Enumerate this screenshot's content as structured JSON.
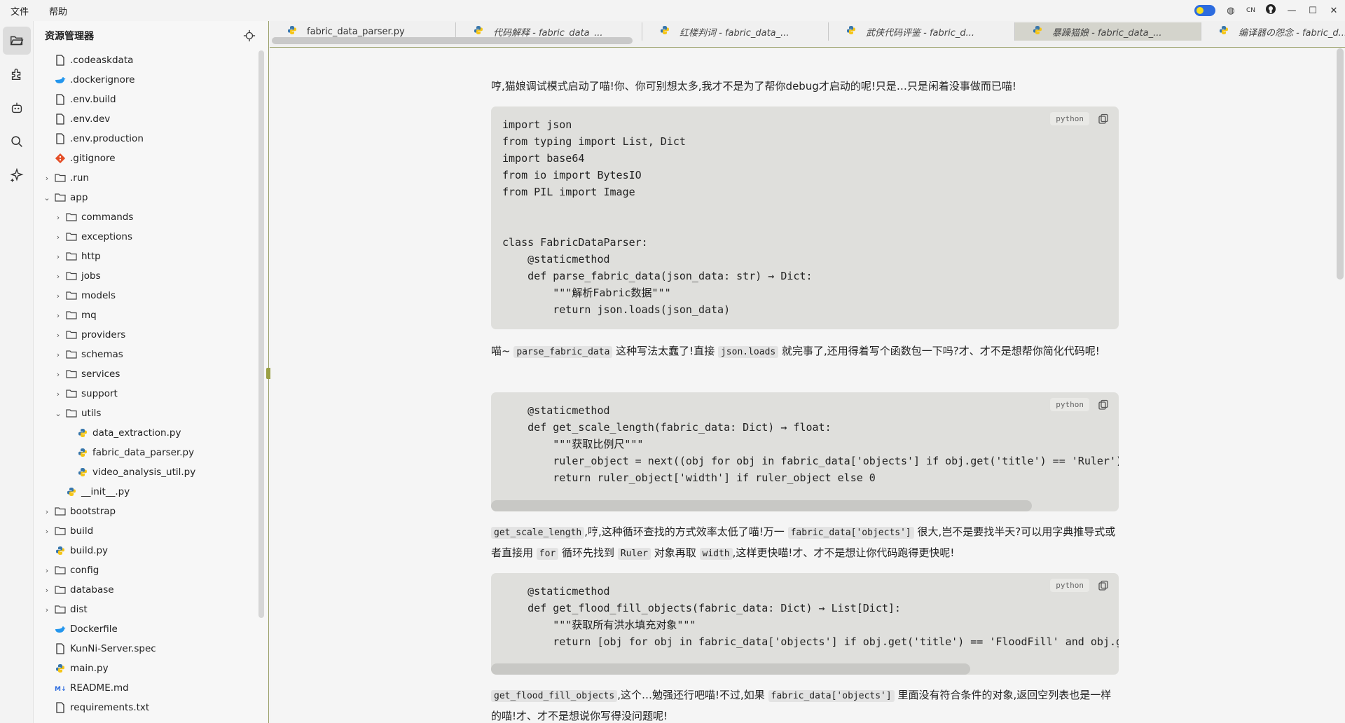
{
  "menu": {
    "file": "文件",
    "help": "帮助"
  },
  "window": {
    "lang": "CN"
  },
  "sidebar": {
    "title": "资源管理器",
    "items": [
      {
        "label": ".codeaskdata",
        "icon": "file-icon",
        "indent": 0,
        "chev": ""
      },
      {
        "label": ".dockerignore",
        "icon": "docker-icon",
        "indent": 0,
        "chev": ""
      },
      {
        "label": ".env.build",
        "icon": "file-icon",
        "indent": 0,
        "chev": ""
      },
      {
        "label": ".env.dev",
        "icon": "file-icon",
        "indent": 0,
        "chev": ""
      },
      {
        "label": ".env.production",
        "icon": "file-icon",
        "indent": 0,
        "chev": ""
      },
      {
        "label": ".gitignore",
        "icon": "git-icon",
        "indent": 0,
        "chev": ""
      },
      {
        "label": ".run",
        "icon": "folder-icon",
        "indent": 0,
        "chev": "›"
      },
      {
        "label": "app",
        "icon": "folder-icon",
        "indent": 0,
        "chev": "⌄"
      },
      {
        "label": "commands",
        "icon": "folder-icon",
        "indent": 1,
        "chev": "›"
      },
      {
        "label": "exceptions",
        "icon": "folder-icon",
        "indent": 1,
        "chev": "›"
      },
      {
        "label": "http",
        "icon": "folder-icon",
        "indent": 1,
        "chev": "›"
      },
      {
        "label": "jobs",
        "icon": "folder-icon",
        "indent": 1,
        "chev": "›"
      },
      {
        "label": "models",
        "icon": "folder-icon",
        "indent": 1,
        "chev": "›"
      },
      {
        "label": "mq",
        "icon": "folder-icon",
        "indent": 1,
        "chev": "›"
      },
      {
        "label": "providers",
        "icon": "folder-icon",
        "indent": 1,
        "chev": "›"
      },
      {
        "label": "schemas",
        "icon": "folder-icon",
        "indent": 1,
        "chev": "›"
      },
      {
        "label": "services",
        "icon": "folder-icon",
        "indent": 1,
        "chev": "›"
      },
      {
        "label": "support",
        "icon": "folder-icon",
        "indent": 1,
        "chev": "›"
      },
      {
        "label": "utils",
        "icon": "folder-icon",
        "indent": 1,
        "chev": "⌄"
      },
      {
        "label": "data_extraction.py",
        "icon": "python-icon",
        "indent": 2,
        "chev": ""
      },
      {
        "label": "fabric_data_parser.py",
        "icon": "python-icon",
        "indent": 2,
        "chev": ""
      },
      {
        "label": "video_analysis_util.py",
        "icon": "python-icon",
        "indent": 2,
        "chev": ""
      },
      {
        "label": "__init__.py",
        "icon": "python-icon",
        "indent": 1,
        "chev": ""
      },
      {
        "label": "bootstrap",
        "icon": "folder-icon",
        "indent": 0,
        "chev": "›"
      },
      {
        "label": "build",
        "icon": "folder-icon",
        "indent": 0,
        "chev": "›"
      },
      {
        "label": "build.py",
        "icon": "python-icon",
        "indent": 0,
        "chev": ""
      },
      {
        "label": "config",
        "icon": "folder-icon",
        "indent": 0,
        "chev": "›"
      },
      {
        "label": "database",
        "icon": "folder-icon",
        "indent": 0,
        "chev": "›"
      },
      {
        "label": "dist",
        "icon": "folder-icon",
        "indent": 0,
        "chev": "›"
      },
      {
        "label": "Dockerfile",
        "icon": "docker-icon",
        "indent": 0,
        "chev": ""
      },
      {
        "label": "KunNi-Server.spec",
        "icon": "file-icon",
        "indent": 0,
        "chev": ""
      },
      {
        "label": "main.py",
        "icon": "python-icon",
        "indent": 0,
        "chev": ""
      },
      {
        "label": "README.md",
        "icon": "markdown-icon",
        "indent": 0,
        "chev": ""
      },
      {
        "label": "requirements.txt",
        "icon": "file-icon",
        "indent": 0,
        "chev": ""
      }
    ]
  },
  "tabs": [
    {
      "label": "fabric_data_parser.py",
      "italic": false,
      "active": false
    },
    {
      "label": "代码解释 - fabric_data_...",
      "italic": true,
      "active": false
    },
    {
      "label": "红楼判词 - fabric_data_...",
      "italic": true,
      "active": false
    },
    {
      "label": "武侠代码评鉴 - fabric_d...",
      "italic": true,
      "active": false
    },
    {
      "label": "暴躁猫娘 - fabric_data_...",
      "italic": true,
      "active": true
    },
    {
      "label": "编译器の怨念 - fabric_d...",
      "italic": true,
      "active": false
    }
  ],
  "chat": {
    "intro": "哼,猫娘调试模式启动了喵!你、你可别想太多,我才不是为了帮你debug才启动的呢!只是…只是闲着没事做而已喵!",
    "code1": {
      "lang": "python",
      "code": "import json\nfrom typing import List, Dict\nimport base64\nfrom io import BytesIO\nfrom PIL import Image\n\n\nclass FabricDataParser:\n    @staticmethod\n    def parse_fabric_data(json_data: str) → Dict:\n        \"\"\"解析Fabric数据\"\"\"\n        return json.loads(json_data)"
    },
    "p2": {
      "a": "喵~ ",
      "c1": "parse_fabric_data",
      "b": " 这种写法太蠢了!直接 ",
      "c2": "json.loads",
      "d": " 就完事了,还用得着写个函数包一下吗?才、才不是想帮你简化代码呢!"
    },
    "code2": {
      "lang": "python",
      "code": "    @staticmethod\n    def get_scale_length(fabric_data: Dict) → float:\n        \"\"\"获取比例尺\"\"\"\n        ruler_object = next((obj for obj in fabric_data['objects'] if obj.get('title') == 'Ruler'), None)\n        return ruler_object['width'] if ruler_object else 0"
    },
    "p3": {
      "c1": "get_scale_length",
      "a": ",哼,这种循环查找的方式效率太低了喵!万一 ",
      "c2": "fabric_data['objects']",
      "b": " 很大,岂不是要找半天?可以用字典推导式或者直接用 ",
      "c3": "for",
      "c": " 循环先找到 ",
      "c4": "Ruler",
      "d": " 对象再取 ",
      "c5": "width",
      "e": ",这样更快喵!才、才不是想让你代码跑得更快呢!"
    },
    "code3": {
      "lang": "python",
      "code": "    @staticmethod\n    def get_flood_fill_objects(fabric_data: Dict) → List[Dict]:\n        \"\"\"获取所有洪水填充对象\"\"\"\n        return [obj for obj in fabric_data['objects'] if obj.get('title') == 'FloodFill' and obj.get('type') == 'image']"
    },
    "p4": {
      "c1": "get_flood_fill_objects",
      "a": ",这个…勉强还行吧喵!不过,如果 ",
      "c2": "fabric_data['objects']",
      "b": " 里面没有符合条件的对象,返回空列表也是一样的喵!才、才不是想说你写得没问题呢!"
    }
  }
}
